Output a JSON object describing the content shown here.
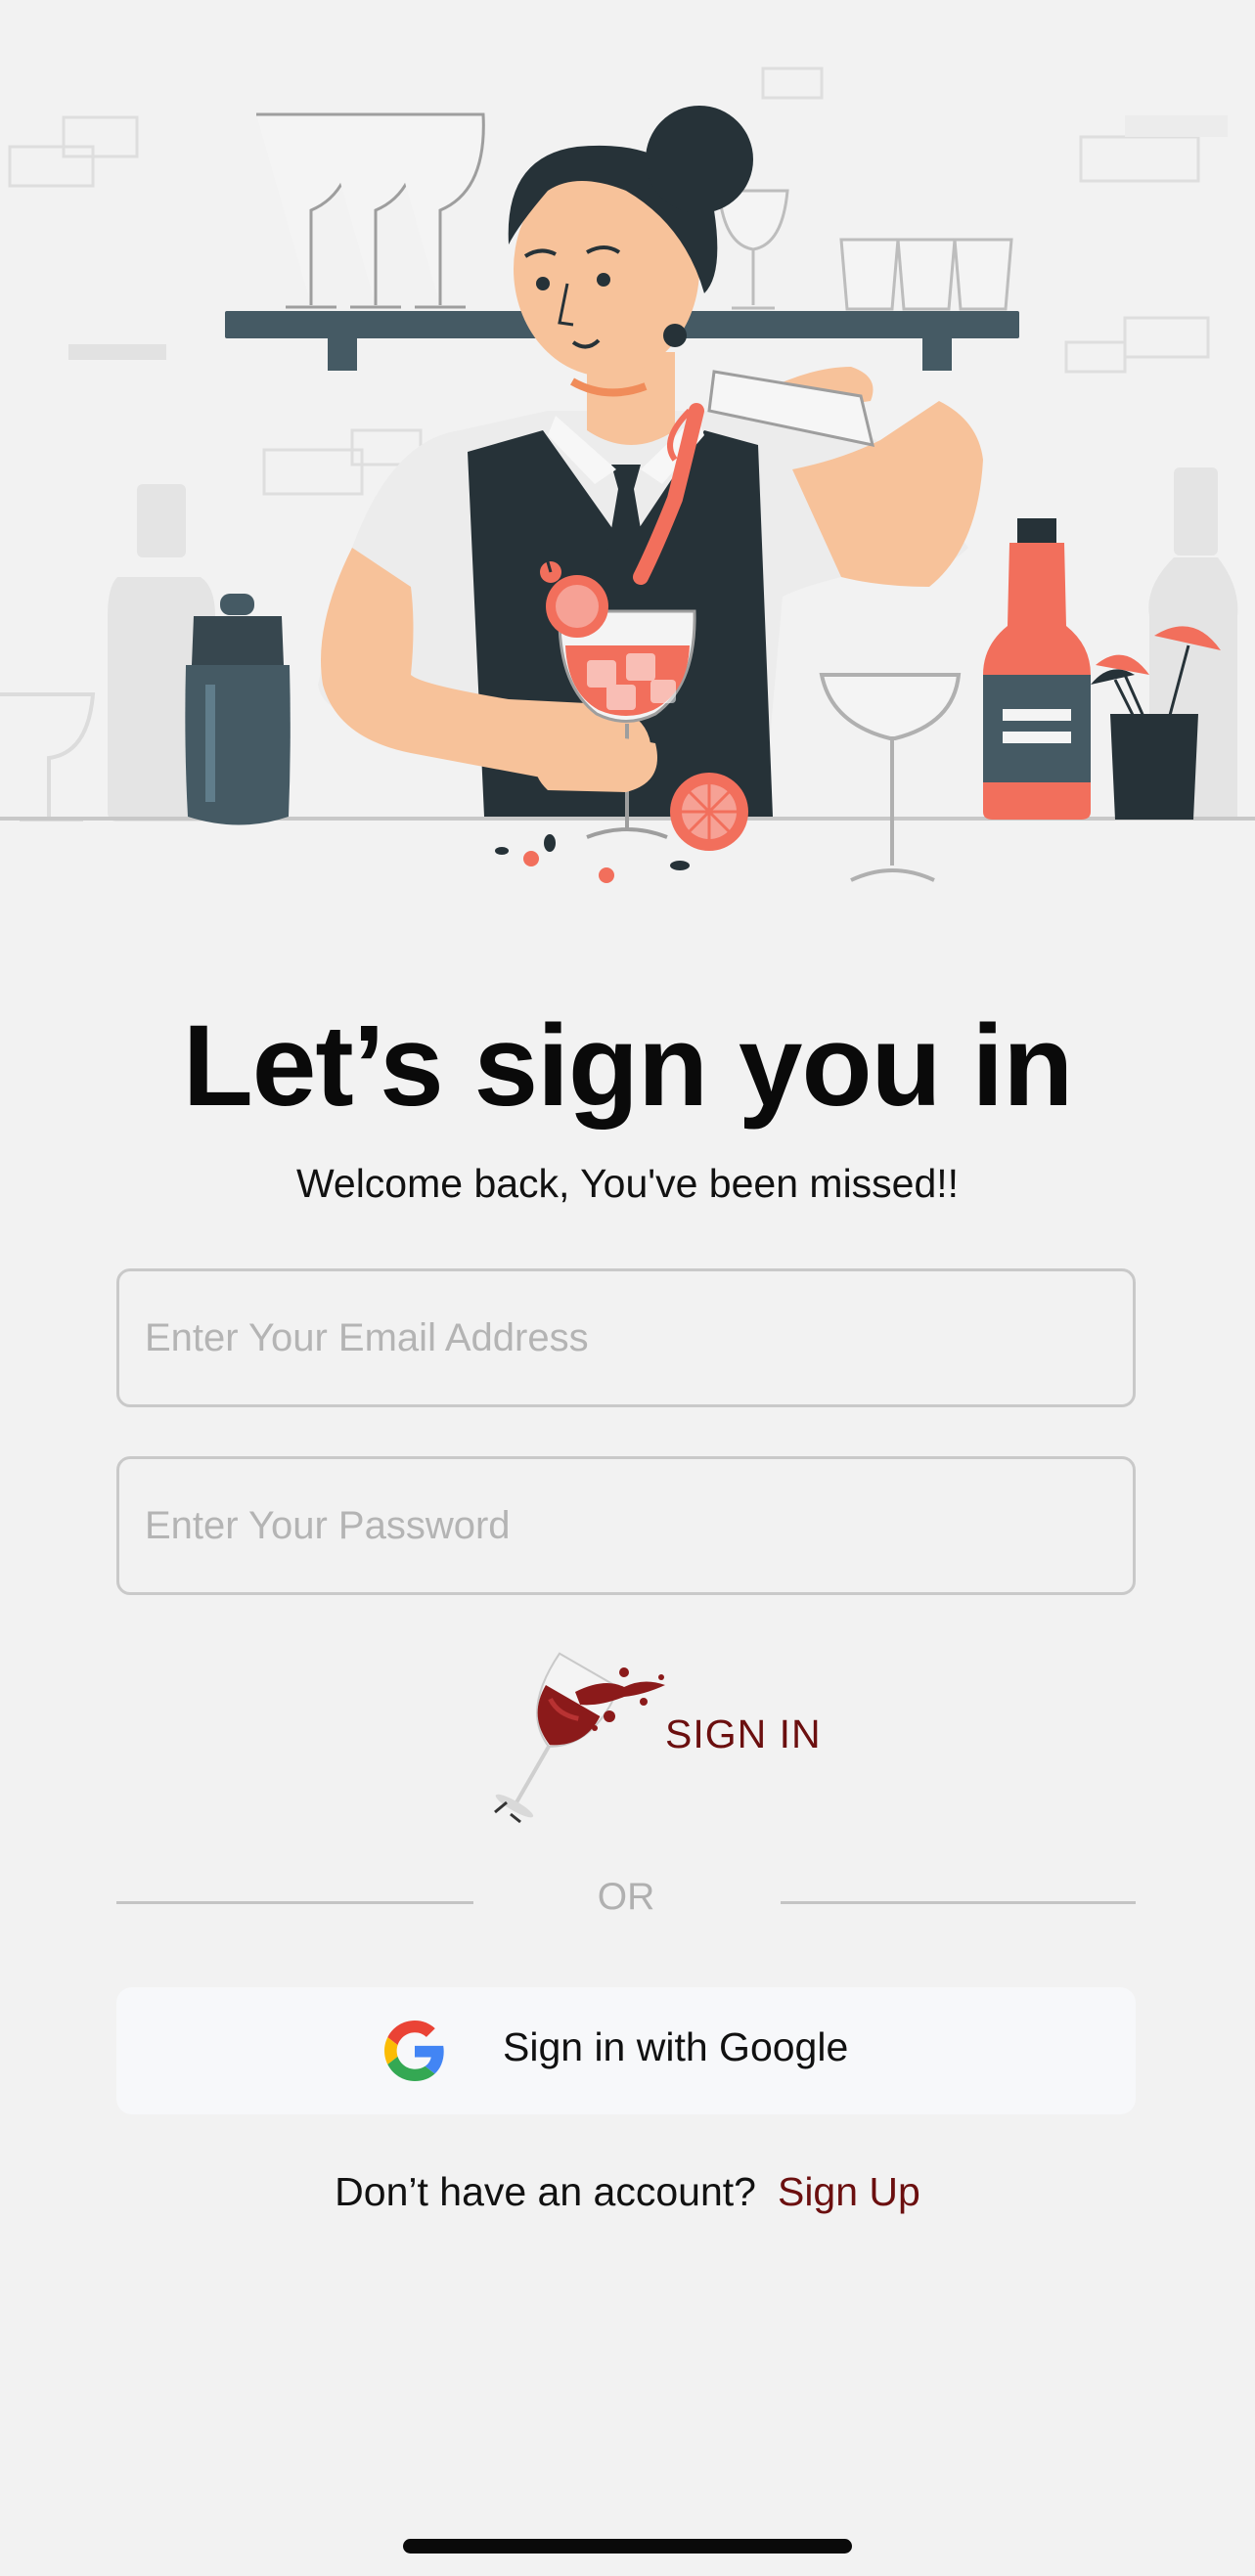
{
  "illustration": {
    "icon": "bartender-illustration",
    "palette": {
      "dark": "#263238",
      "coral": "#f26f5c",
      "skin": "#f7c29a",
      "shirt": "#e9e9e9"
    }
  },
  "signin": {
    "title": "Let’s sign you in",
    "subtitle": "Welcome back, You've been missed!!",
    "email_placeholder": "Enter Your Email Address",
    "password_placeholder": "Enter Your Password",
    "button_label": "SIGN IN",
    "button_icon": "wine-glass-splash-icon",
    "divider_label": "OR",
    "google_label": "Sign in with Google",
    "google_icon": "google-icon",
    "no_account_text": "Don’t have an account?",
    "signup_link": "Sign Up"
  },
  "colors": {
    "background": "#f2f2f2",
    "accent": "#6b0f0f",
    "field_border": "#c9c9c9",
    "placeholder": "#b4b4b4"
  }
}
